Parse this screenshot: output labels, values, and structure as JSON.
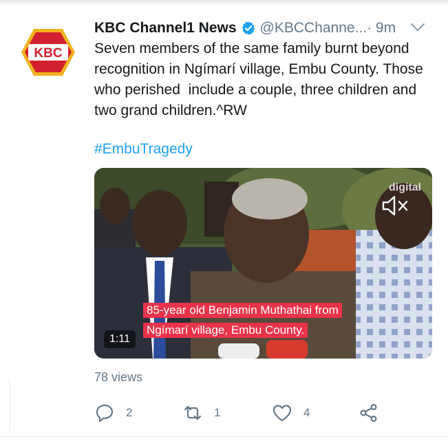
{
  "account": {
    "name": "KBC Channel1 News",
    "handle": "@KBCChanne...",
    "time": "· 9m",
    "avatar_text": "KBC"
  },
  "tweet": {
    "text": "Seven members of the same family burnt beyond recognition in Ngímarí village, Embu County. Those who perished  include a couple, three children and two grand children.^RW",
    "hashtag": "#EmbuTragedy"
  },
  "media": {
    "caption_line_1": "85-year old Benjamin Muthathai from",
    "caption_line_2": "Ngímarí village, Embu County.",
    "duration": "1:11",
    "watermark": "digital"
  },
  "stats": {
    "views": "78 views",
    "replies": "2",
    "retweets": "1",
    "likes": "4"
  },
  "colors": {
    "link": "#1da1f2",
    "muted": "#657786",
    "caption_bg": "#e8334a",
    "kbc_red": "#d2202f",
    "kbc_gold": "#f2b01e"
  },
  "icons": [
    "verified-badge-icon",
    "chevron-down-icon",
    "mute-icon",
    "reply-icon",
    "retweet-icon",
    "like-icon",
    "share-icon"
  ]
}
